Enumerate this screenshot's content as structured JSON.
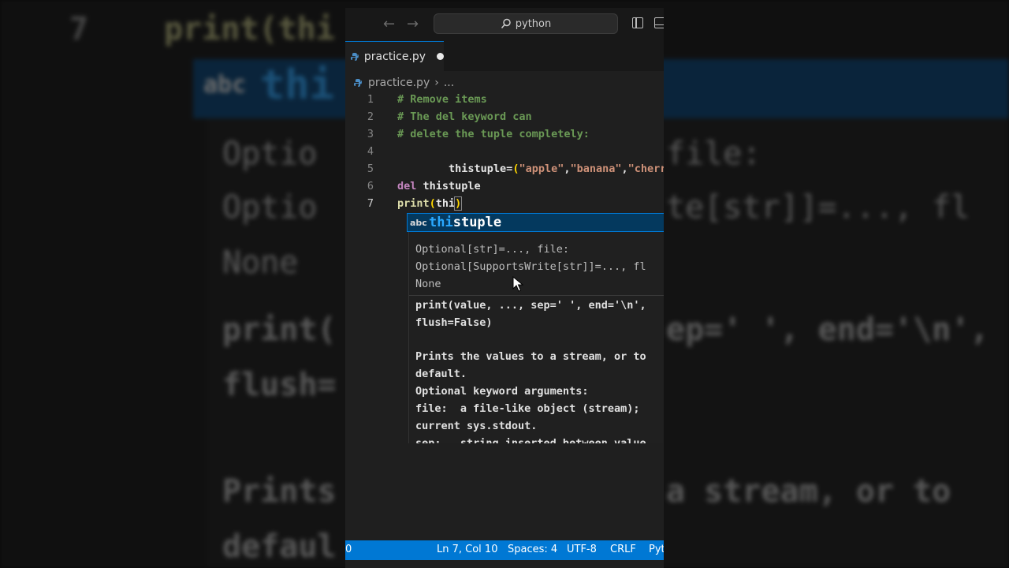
{
  "background": {
    "line_no": "7",
    "code": "print(thi",
    "abc": "abc",
    "suggestion": "thi",
    "doc_lines": [
      "Optio",
      "Optio",
      "None",
      "print(",
      "flush=",
      "Prints",
      "defaul"
    ],
    "right_lines": [
      "file:",
      "te[str]]=..., fl",
      "ep=' ', end='\\n',",
      "a stream, or to"
    ]
  },
  "titlebar": {
    "search_text": "python"
  },
  "tab": {
    "file_name": "practice.py"
  },
  "breadcrumb": {
    "file": "practice.py",
    "more": "..."
  },
  "code": {
    "line_numbers": [
      "1",
      "2",
      "3",
      "4",
      "5",
      "6",
      "7"
    ],
    "line1": "# Remove items",
    "line2": "# The del keyword can",
    "line3": "# delete the tuple completely:",
    "line5_id": "thistuple=",
    "line5_open": "(",
    "line5_s1": "\"apple\"",
    "line5_comma1": ",",
    "line5_s2": "\"banana\"",
    "line5_comma2": ",",
    "line5_s3": "\"cherry\"",
    "line5_close": ")",
    "line6_kw": "del",
    "line6_id": " thistuple",
    "line7_fn": "print",
    "line7_open": "(",
    "line7_id": "thi",
    "line7_close": ")"
  },
  "suggestion": {
    "kind": "abc",
    "match": "thi",
    "rest": "stuple"
  },
  "doc": {
    "sig_lines": [
      "Optional[str]=..., file:",
      "Optional[SupportsWrite[str]]=..., fl",
      "None"
    ],
    "text_lines": [
      "print(value, ..., sep=' ', end='\\n',",
      "flush=False)",
      "",
      "Prints the values to a stream, or to",
      "default.",
      "Optional keyword arguments:",
      "file:  a file-like object (stream);",
      "current sys.stdout.",
      "sep:   string inserted between value"
    ]
  },
  "statusbar": {
    "left": "0",
    "position": "Ln 7, Col 10",
    "spaces": "Spaces: 4",
    "encoding": "UTF-8",
    "eol": "CRLF",
    "language": "Pyt"
  },
  "colors": {
    "status_bar": "#0078d4",
    "editor_bg": "#1f1f1f",
    "comment": "#6a9955",
    "string": "#ce9178",
    "keyword": "#c586c0",
    "suggest_highlight": "#2aa9ff"
  }
}
